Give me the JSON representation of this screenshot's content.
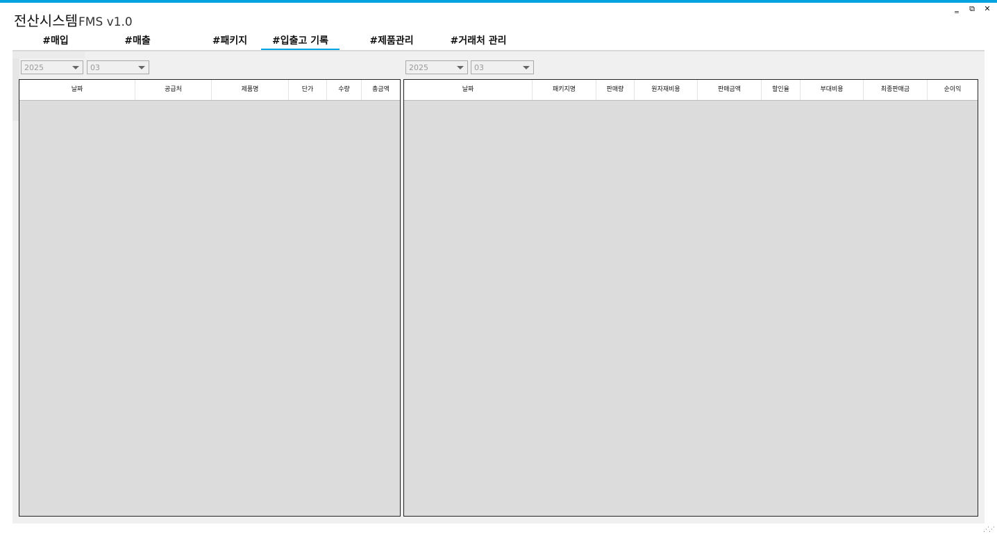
{
  "app": {
    "title_korean": "전산시스템",
    "title_suffix": "FMS v1.0",
    "accent_color": "#00a2e0"
  },
  "window_controls": {
    "minimize": "‗",
    "restore": "⧉",
    "close": "✕"
  },
  "tabs": [
    {
      "label": "#매입",
      "active": false
    },
    {
      "label": "#매출",
      "active": false
    },
    {
      "label": "#패키지",
      "active": false
    },
    {
      "label": "#입출고 기록",
      "active": true
    },
    {
      "label": "#제품관리",
      "active": false
    },
    {
      "label": "#거래처 관리",
      "active": false
    }
  ],
  "left": {
    "year": "2025",
    "month": "03",
    "columns": [
      "날짜",
      "공급처",
      "제품명",
      "단가",
      "수량",
      "총금액"
    ]
  },
  "right": {
    "year": "2025",
    "month": "03",
    "columns": [
      "날짜",
      "패키지명",
      "판매량",
      "원자재비용",
      "판매금액",
      "할인율",
      "부대비용",
      "최종판매금",
      "순이익"
    ]
  }
}
